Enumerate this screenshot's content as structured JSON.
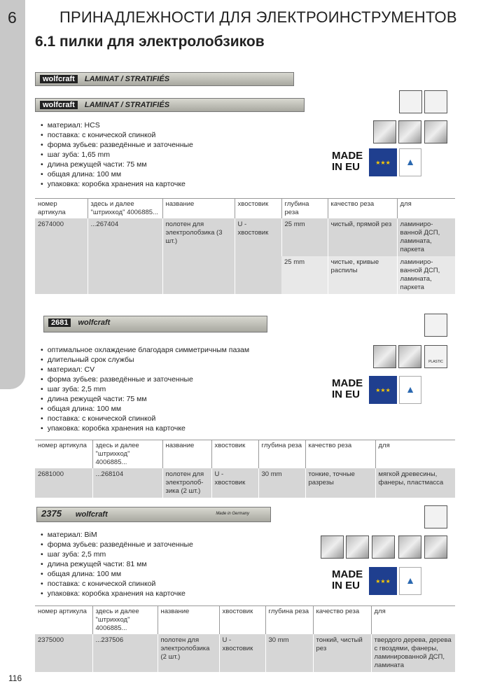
{
  "header": {
    "chapter": "6",
    "title": "ПРИНАДЛЕЖНОСТИ ДЛЯ ЭЛЕКТРОИНСТРУМЕНТОВ",
    "subtitle": "6.1 пилки для электролобзиков"
  },
  "badge": {
    "line1": "MADE",
    "line2": "IN EU"
  },
  "sections": [
    {
      "blade_logo": "wolfcraft",
      "blade_text": "LAMINAT / STRATIFIÉS",
      "bullets": [
        "материал: HCS",
        "поставка: с конической спинкой",
        "форма зубьев: разведённые и заточенные",
        "шаг зуба: 1,65 mm",
        "длина режущей части: 75 мм",
        "общая длина: 100 мм",
        "упаковка: коробка хранения на карточке"
      ],
      "headers": [
        "номер артикула",
        "здесь и далее \"штрихкод\" 4006885...",
        "название",
        "хвостовик",
        "глубина реза",
        "качество реза",
        "для"
      ],
      "rows": [
        [
          "2674000",
          "...267404",
          "полотен для электролобзика (3 шт.)",
          "U - хвостовик",
          "25 mm",
          "чистый, прямой рез",
          "ламиниро-ванной ДСП, ламината, паркета"
        ],
        [
          "",
          "",
          "",
          "",
          "25 mm",
          "чистые, кривые распилы",
          "ламиниро-ванной ДСП, ламината, паркета"
        ]
      ]
    },
    {
      "blade_logo": "2681",
      "blade_text": "wolfcraft",
      "bullets": [
        "оптимальное охлаждение благодаря симметричным пазам",
        "длительный срок службы",
        "материал: CV",
        "форма зубьев: разведённые и заточенные",
        "шаг зуба: 2,5 mm",
        "длина режущей части: 75 мм",
        "общая длина: 100 мм",
        "поставка: с конической спинкой",
        "упаковка: коробка хранения на карточке"
      ],
      "icon_label": "PLASTIC",
      "headers": [
        "номер артикула",
        "здесь и далее \"штрихкод\" 4006885...",
        "название",
        "хвостовик",
        "глубина реза",
        "качество реза",
        "для"
      ],
      "rows": [
        [
          "2681000",
          "...268104",
          "полотен для электролоб-зика (2 шт.)",
          "U - хвостовик",
          "30 mm",
          "тонкие, точные разрезы",
          "мягкой древесины, фанеры, пластмасса"
        ]
      ]
    },
    {
      "blade_logo": "2375",
      "blade_text": "wolfcraft",
      "blade_made": "Made in Germany",
      "bullets": [
        "материал: BiM",
        "форма зубьев: разведённые и заточенные",
        "шаг зуба: 2,5 mm",
        "длина режущей части: 81 мм",
        "общая длина: 100 мм",
        "поставка: с конической спинкой",
        "упаковка: коробка хранения на карточке"
      ],
      "headers": [
        "номер артикула",
        "здесь и далее \"штрихкод\" 4006885...",
        "название",
        "хвостовик",
        "глубина реза",
        "качество реза",
        "для"
      ],
      "rows": [
        [
          "2375000",
          "...237506",
          "полотен для электролобзика (2 шт.)",
          "U - хвостовик",
          "30 mm",
          "тонкий, чистый рез",
          "твердого дерева, дерева с гвоздями, фанеры, ламинированной ДСП, ламината"
        ]
      ]
    }
  ],
  "page_number": "116"
}
